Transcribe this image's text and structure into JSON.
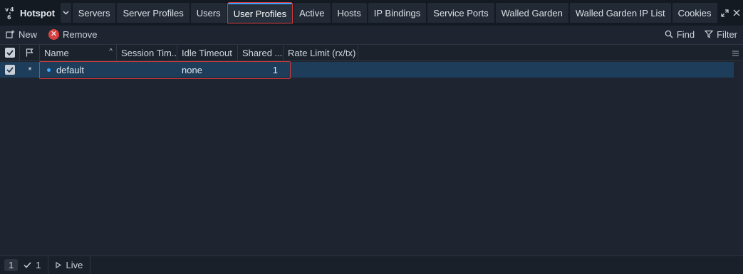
{
  "app": {
    "title": "Hotspot"
  },
  "tabs": [
    {
      "label": "Servers",
      "active": false
    },
    {
      "label": "Server Profiles",
      "active": false
    },
    {
      "label": "Users",
      "active": false
    },
    {
      "label": "User Profiles",
      "active": true
    },
    {
      "label": "Active",
      "active": false
    },
    {
      "label": "Hosts",
      "active": false
    },
    {
      "label": "IP Bindings",
      "active": false
    },
    {
      "label": "Service Ports",
      "active": false
    },
    {
      "label": "Walled Garden",
      "active": false
    },
    {
      "label": "Walled Garden IP List",
      "active": false
    },
    {
      "label": "Cookies",
      "active": false
    }
  ],
  "toolbar": {
    "new_label": "New",
    "remove_label": "Remove",
    "find_label": "Find",
    "filter_label": "Filter"
  },
  "table": {
    "columns": {
      "name": "Name",
      "session_timeout": "Session Tim...",
      "idle_timeout": "Idle Timeout",
      "shared_users": "Shared ...",
      "rate_limit": "Rate Limit (rx/tx)"
    },
    "rows": [
      {
        "flag": "*",
        "name": "default",
        "session_timeout": "",
        "idle_timeout": "none",
        "shared_users": "1",
        "rate_limit": ""
      }
    ]
  },
  "status": {
    "total": "1",
    "selected": "1",
    "live_label": "Live"
  },
  "colors": {
    "accent": "#3ea6ff",
    "highlight": "#d33a3a",
    "selection": "#1d3d5a"
  }
}
